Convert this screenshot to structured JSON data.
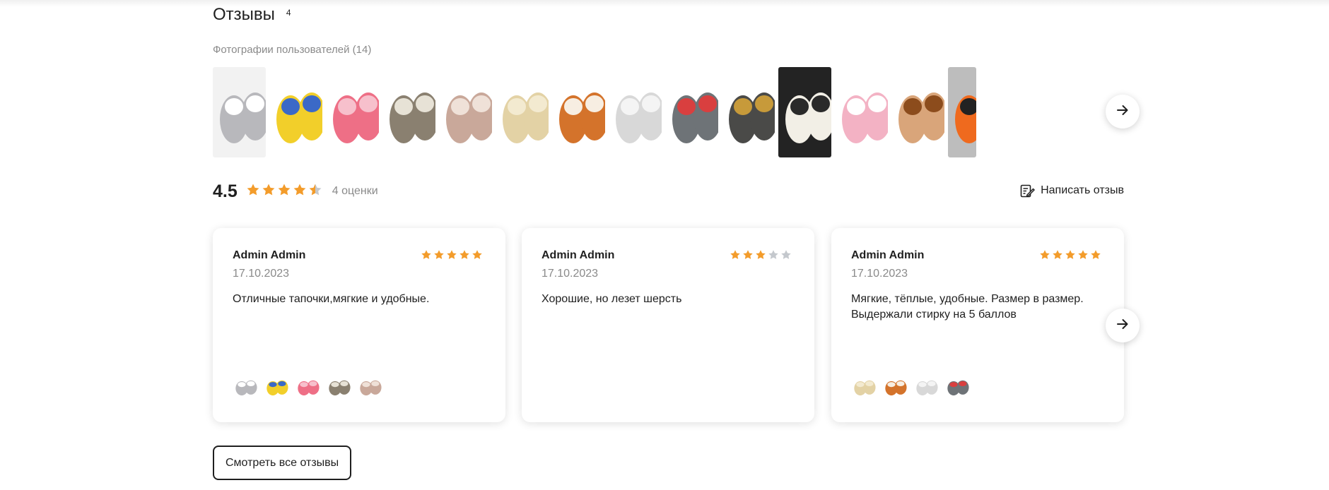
{
  "reviews": {
    "title": "Отзывы",
    "count": "4",
    "photos_label": "Фотографии пользователей (14)",
    "photos": [
      {
        "icon": "grey-cat-slippers",
        "bg": "#f2f2f2",
        "main": "#b8b8bc",
        "accent": "#ffffff"
      },
      {
        "icon": "minion-slippers",
        "bg": "#ffffff",
        "main": "#f2cf2a",
        "accent": "#3b69c7"
      },
      {
        "icon": "pink-fur-slippers",
        "bg": "#ffffff",
        "main": "#ee6f86",
        "accent": "#f7c0cc"
      },
      {
        "icon": "grey-felt-slippers",
        "bg": "#ffffff",
        "main": "#8a8070",
        "accent": "#e7e2d6"
      },
      {
        "icon": "pink-felt-slippers",
        "bg": "#ffffff",
        "main": "#c9a89a",
        "accent": "#efe1d8"
      },
      {
        "icon": "beige-sheepskin-slippers",
        "bg": "#ffffff",
        "main": "#e3d2a5",
        "accent": "#f3ead0"
      },
      {
        "icon": "orange-fur-slippers",
        "bg": "#ffffff",
        "main": "#d4732b",
        "accent": "#f7eee2"
      },
      {
        "icon": "unicorn-slippers",
        "bg": "#ffffff",
        "main": "#d8d8d8",
        "accent": "#f4f4f4"
      },
      {
        "icon": "shark-slippers",
        "bg": "#ffffff",
        "main": "#6e7377",
        "accent": "#d93f3f"
      },
      {
        "icon": "dark-felt-slippers",
        "bg": "#ffffff",
        "main": "#4a4a48",
        "accent": "#c79a3a"
      },
      {
        "icon": "panda-slippers",
        "bg": "#232323",
        "main": "#f2efe6",
        "accent": "#2a2a2a"
      },
      {
        "icon": "pink-pig-slippers",
        "bg": "#ffffff",
        "main": "#f3b2c4",
        "accent": "#ffffff"
      },
      {
        "icon": "lion-slippers",
        "bg": "#ffffff",
        "main": "#d9a57a",
        "accent": "#8c4c1c"
      },
      {
        "icon": "orange-slippers",
        "bg": "#bdbdbd",
        "main": "#ef6a1e",
        "accent": "#222222"
      }
    ],
    "average": "4.5",
    "average_value": 4.5,
    "ratings_label": "4 оценки",
    "write_label": "Написать отзыв",
    "all_label": "Смотреть все отзывы",
    "colors": {
      "star": "#f39c2b",
      "star_empty": "#c4c8cd",
      "muted": "#8a8a8a"
    },
    "items": [
      {
        "author": "Admin Admin",
        "date": "17.10.2023",
        "text": "Отличные тапочки,мягкие и удобные.",
        "rating": 5,
        "photos": [
          0,
          1,
          2,
          3,
          4
        ]
      },
      {
        "author": "Admin Admin",
        "date": "17.10.2023",
        "text": "Хорошие, но лезет шерсть",
        "rating": 3,
        "photos": []
      },
      {
        "author": "Admin Admin",
        "date": "17.10.2023",
        "text": "Мягкие, тёплые, удобные. Размер в размер. Выдержали стирку на 5 баллов",
        "rating": 5,
        "photos": [
          5,
          6,
          7,
          8
        ]
      }
    ]
  }
}
